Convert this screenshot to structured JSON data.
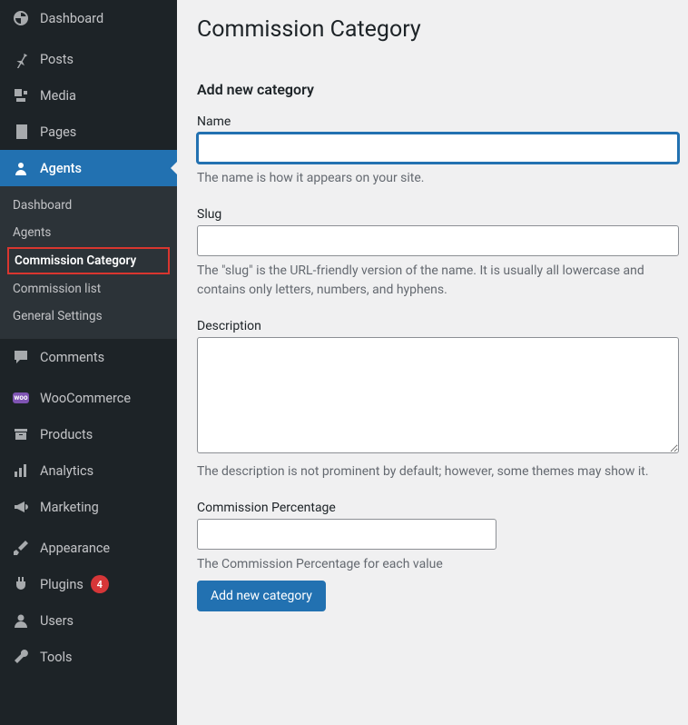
{
  "sidebar": {
    "dashboard": "Dashboard",
    "posts": "Posts",
    "media": "Media",
    "pages": "Pages",
    "agents": "Agents",
    "agents_sub": {
      "dashboard": "Dashboard",
      "agents": "Agents",
      "commission_category": "Commission Category",
      "commission_list": "Commission list",
      "general_settings": "General Settings"
    },
    "comments": "Comments",
    "woocommerce": "WooCommerce",
    "products": "Products",
    "analytics": "Analytics",
    "marketing": "Marketing",
    "appearance": "Appearance",
    "plugins": "Plugins",
    "plugins_badge": "4",
    "users": "Users",
    "tools": "Tools"
  },
  "page": {
    "title": "Commission Category",
    "section": "Add new category",
    "name_label": "Name",
    "name_value": "",
    "name_help": "The name is how it appears on your site.",
    "slug_label": "Slug",
    "slug_value": "",
    "slug_help": "The \"slug\" is the URL-friendly version of the name. It is usually all lowercase and contains only letters, numbers, and hyphens.",
    "desc_label": "Description",
    "desc_value": "",
    "desc_help": "The description is not prominent by default; however, some themes may show it.",
    "pct_label": "Commission Percentage",
    "pct_value": "",
    "pct_help": "The Commission Percentage for each value",
    "submit": "Add new category"
  }
}
